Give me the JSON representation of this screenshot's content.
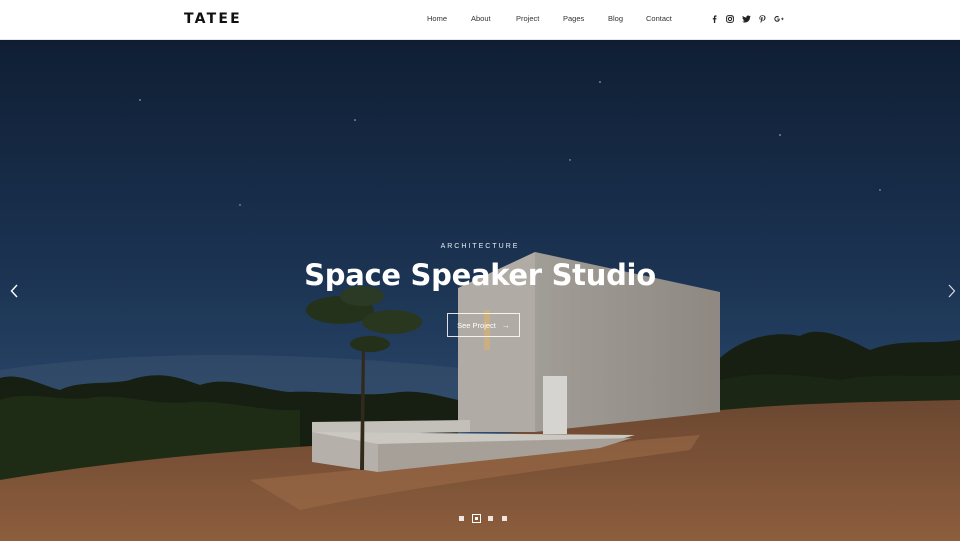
{
  "brand": {
    "logo": "TATEE"
  },
  "nav": {
    "items": [
      {
        "label": "Home"
      },
      {
        "label": "About"
      },
      {
        "label": "Project"
      },
      {
        "label": "Pages"
      },
      {
        "label": "Blog"
      },
      {
        "label": "Contact"
      }
    ]
  },
  "social": [
    "facebook-icon",
    "instagram-icon",
    "twitter-icon",
    "pinterest-icon",
    "google-plus-icon"
  ],
  "hero": {
    "kicker": "ARCHITECTURE",
    "title": "Space Speaker Studio",
    "cta_label": "See Project",
    "cta_arrow": "→"
  },
  "slider": {
    "slide_count": 4,
    "active_index": 1
  },
  "colors": {
    "sky_top": "#12233c",
    "sky_mid": "#28476e",
    "ground": "#8a5b3c"
  }
}
